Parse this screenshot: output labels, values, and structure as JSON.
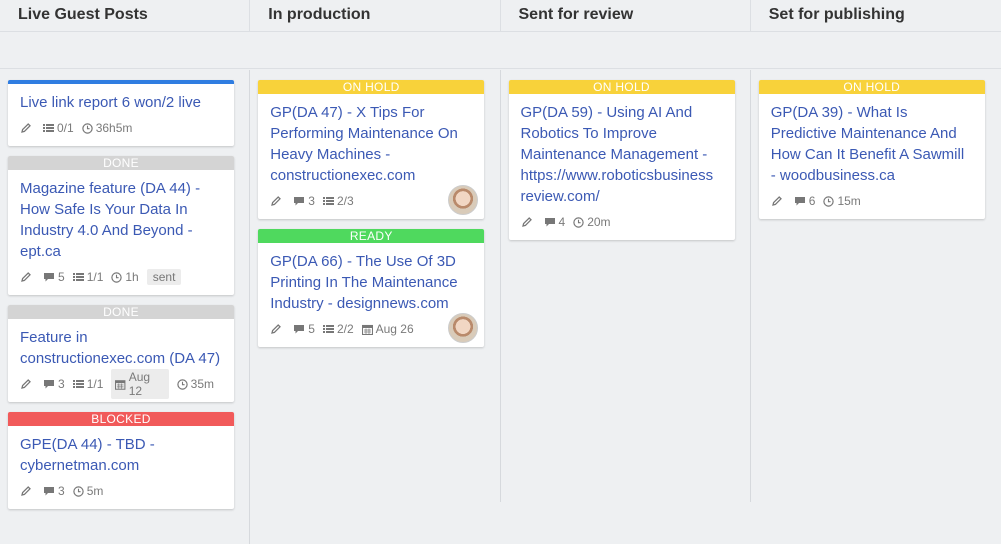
{
  "columns": [
    {
      "title": "Live Guest Posts",
      "cards": [
        {
          "status": "",
          "title": "Live link report 6 won/2 live",
          "checklist": "0/1",
          "time": "36h5m"
        },
        {
          "status": "DONE",
          "title": "Magazine feature (DA 44) - How Safe Is Your Data In Industry 4.0 And Beyond - ept.ca",
          "comments": "5",
          "checklist": "1/1",
          "time": "1h",
          "tag": "sent"
        },
        {
          "status": "DONE",
          "title": "Feature in constructionexec.com (DA 47)",
          "comments": "3",
          "checklist": "1/1",
          "date": "Aug 12",
          "time": "35m"
        },
        {
          "status": "BLOCKED",
          "title": "GPE(DA 44) - TBD - cybernetman.com",
          "comments": "3",
          "time": "5m"
        }
      ]
    },
    {
      "title": "In production",
      "cards": [
        {
          "status": "ON HOLD",
          "title": "GP(DA 47) - X Tips For Performing Maintenance On Heavy Machines - constructionexec.com",
          "comments": "3",
          "checklist": "2/3"
        },
        {
          "status": "READY",
          "title": "GP(DA 66) - The Use Of 3D Printing In The Maintenance Industry - designnews.com",
          "comments": "5",
          "checklist": "2/2",
          "date": "Aug 26"
        }
      ]
    },
    {
      "title": "Sent for review",
      "cards": [
        {
          "status": "ON HOLD",
          "title": "GP(DA 59) - Using AI And Robotics To Improve Maintenance Management - https://www.roboticsbusiness review.com/",
          "comments": "4",
          "time": "20m"
        }
      ]
    },
    {
      "title": "Set for publishing",
      "cards": [
        {
          "status": "ON HOLD",
          "title": "GP(DA 39) - What Is Predictive Maintenance And How Can It Benefit A Sawmill - woodbusiness.ca",
          "comments": "6",
          "time": "15m"
        }
      ]
    }
  ],
  "colors": {
    "link": "#3b59b4",
    "done": "#d4d4d4",
    "blocked": "#f15a5a",
    "onhold": "#f8d23a",
    "ready": "#4fd95e",
    "accent": "#2f7de1"
  },
  "icons": {
    "edit": "pencil-icon",
    "comments": "comment-icon",
    "checklist": "checklist-icon",
    "time": "clock-icon",
    "date": "calendar-icon"
  }
}
